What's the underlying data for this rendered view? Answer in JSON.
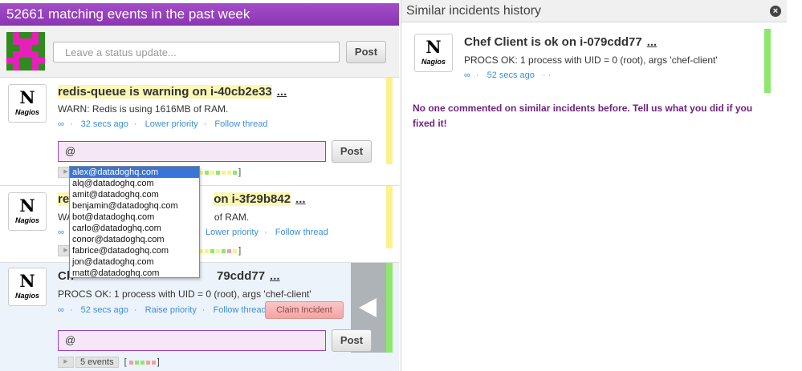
{
  "feed": {
    "header": "52661 matching events in the past week",
    "status_placeholder": "Leave a status update...",
    "post_label": "Post",
    "events": [
      {
        "title": "redis-queue is warning on i-40cb2e33",
        "more": "...",
        "desc": "WARN: Redis is using 1616MB of RAM.",
        "link_icon": "∞",
        "time": "32 secs ago",
        "priority": "Lower priority",
        "follow": "Follow thread",
        "comment_value": "@",
        "post_label": "Post",
        "status_color": "#faf28c"
      },
      {
        "title_hidden_start": "re",
        "title_visible": "on i-3f29b842",
        "more": "...",
        "desc_start": "WA",
        "desc_end": "of RAM.",
        "link_icon": "∞",
        "priority": "Lower priority",
        "follow": "Follow thread",
        "status_color": "#faf28c"
      },
      {
        "title_start": "Ch",
        "title_end": "79cdd77",
        "more": "...",
        "desc": "PROCS OK: 1 process with UID = 0 (root), args 'chef-client'",
        "link_icon": "∞",
        "time": "52 secs ago",
        "priority": "Raise priority",
        "follow": "Follow thread",
        "claim": "Claim Incident",
        "comment_value": "@",
        "post_label": "Post",
        "events_count": "5 events",
        "status_color": "#8fe86d"
      }
    ],
    "autocomplete": [
      "alex@datadoghq.com",
      "alq@datadoghq.com",
      "amit@datadoghq.com",
      "benjamin@datadoghq.com",
      "bot@datadoghq.com",
      "carlo@datadoghq.com",
      "conor@datadoghq.com",
      "fabrice@datadoghq.com",
      "jon@datadoghq.com",
      "matt@datadoghq.com"
    ],
    "nagios_letter": "N",
    "nagios_word": "Nagios"
  },
  "similar": {
    "header": "Similar incidents history",
    "close": "×",
    "title": "Chef Client is ok on i-079cdd77",
    "more": "...",
    "desc": "PROCS OK: 1 process with UID = 0 (root), args 'chef-client'",
    "link_icon": "∞",
    "time": "52 secs ago",
    "dots": "· ·",
    "status_color": "#8fe86d",
    "no_comment": "No one commented on similar incidents before. Tell us what you did if you fixed it!"
  },
  "colors": {
    "brand": "#9b3fc1",
    "link": "#3d8ed8",
    "ok": "#8fe86d",
    "warn": "#faf28c"
  }
}
